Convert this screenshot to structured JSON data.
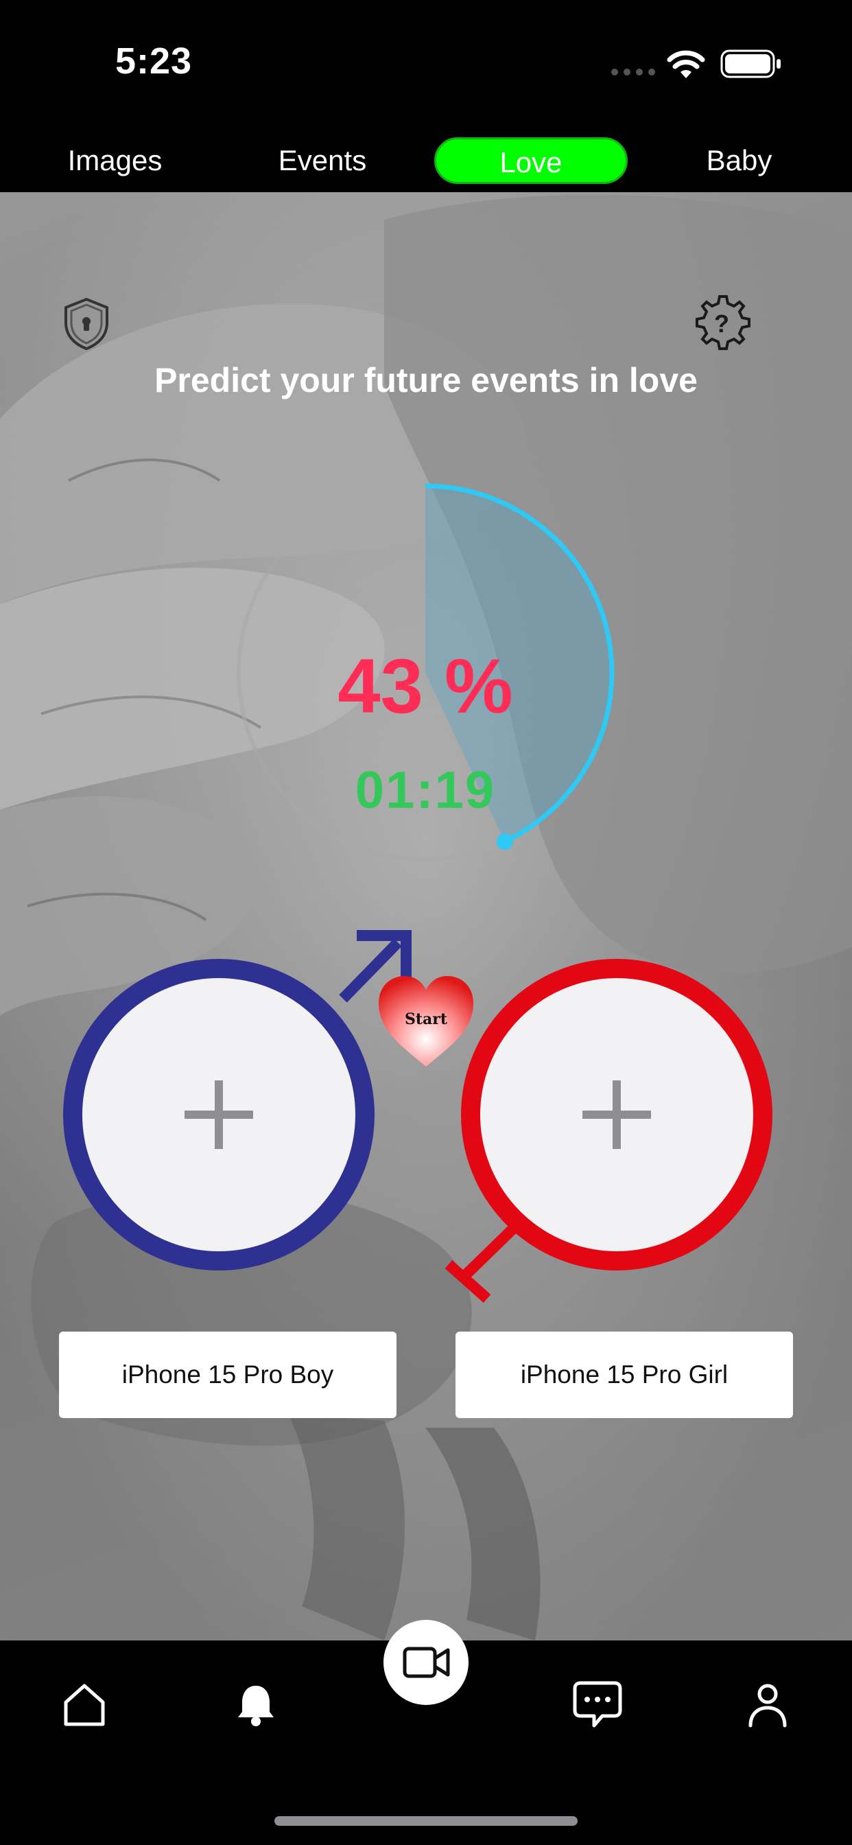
{
  "status_bar": {
    "time": "5:23"
  },
  "tabs": [
    {
      "label": "Images",
      "active": false
    },
    {
      "label": "Events",
      "active": false
    },
    {
      "label": "Love",
      "active": true
    },
    {
      "label": "Baby",
      "active": false
    }
  ],
  "colors": {
    "active_tab": "#00ff00",
    "percent": "#ff2d55",
    "timer": "#34c759",
    "progress_arc": "#2ec9f5",
    "boy": "#2e3192",
    "girl": "#e30613"
  },
  "header": {
    "privacy_icon": "shield-lock-icon",
    "help_icon": "gear-question-icon"
  },
  "headline": "Predict your future events in love",
  "progress": {
    "percent_text": "43 %",
    "value": 0.43,
    "timer": "01:19"
  },
  "start_button": {
    "label": "Start"
  },
  "boy": {
    "name": "iPhone 15 Pro Boy",
    "add_icon": "plus-icon",
    "symbol": "male-symbol-icon"
  },
  "girl": {
    "name": "iPhone 15 Pro Girl",
    "add_icon": "plus-icon",
    "symbol": "female-symbol-icon"
  },
  "bottom_nav": {
    "items": [
      "home-icon",
      "bell-icon",
      "video-camera-icon",
      "chat-icon",
      "profile-icon"
    ]
  }
}
